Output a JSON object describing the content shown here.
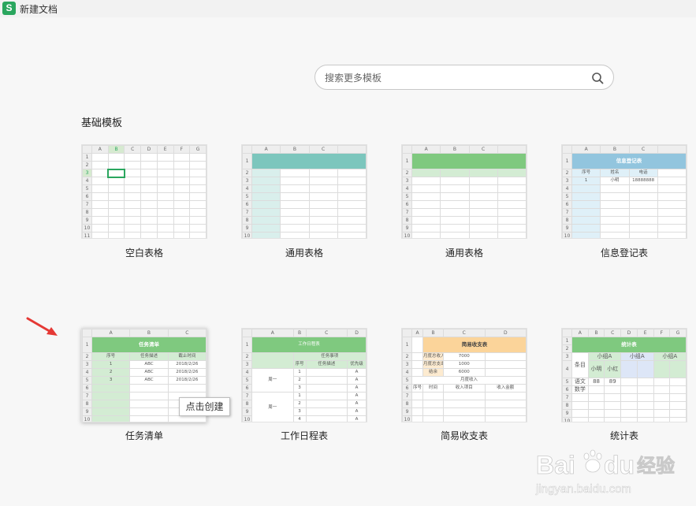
{
  "window": {
    "title": "新建文档",
    "app_icon_letter": "S"
  },
  "search": {
    "placeholder": "搜索更多模板"
  },
  "section": {
    "title": "基础模板"
  },
  "templates": [
    {
      "name": "空白表格"
    },
    {
      "name": "通用表格"
    },
    {
      "name": "通用表格"
    },
    {
      "name": "信息登记表",
      "header": "信息登记表",
      "cols": [
        "序号",
        "姓名",
        "电话"
      ],
      "row": [
        "1",
        "小明",
        "18888888"
      ]
    },
    {
      "name": "任务清单",
      "header": "任务清单",
      "cols": [
        "序号",
        "任务描述",
        "截止时间"
      ],
      "rows": [
        [
          "1",
          "ABC",
          "2018/2/26"
        ],
        [
          "2",
          "ABC",
          "2018/2/26"
        ],
        [
          "3",
          "ABC",
          "2018/2/26"
        ]
      ]
    },
    {
      "name": "工作日程表",
      "header": "工作日程表",
      "sub": "任务事项",
      "cols": [
        "序号",
        "任务描述",
        "优先级"
      ],
      "group1": "周一",
      "group2": "周一",
      "nums": [
        "1",
        "2",
        "3",
        "1",
        "2",
        "3",
        "4"
      ],
      "pri": "A"
    },
    {
      "name": "简易收支表",
      "header": "简易收支表",
      "items": [
        [
          "月度总收入",
          "7000"
        ],
        [
          "月度总支出",
          "1000"
        ],
        [
          "结余",
          "6000"
        ]
      ],
      "sub": "月度收入",
      "cols": [
        "序号",
        "时间",
        "收入项目",
        "收入金额"
      ]
    },
    {
      "name": "统计表",
      "header": "统计表",
      "row_label": "条目",
      "groups": [
        "小组A",
        "小组A",
        "小组A"
      ],
      "members": [
        "小明",
        "小红"
      ],
      "subjects": [
        "语文",
        "数学"
      ],
      "scores": [
        "88",
        "89"
      ]
    }
  ],
  "tooltip": {
    "text": "点击创建"
  },
  "colors": {
    "green": "#2aa65e",
    "teal": "#7cc6bd",
    "light_green": "#7fc97f",
    "blue": "#92c5de",
    "orange": "#fbd49a",
    "red": "#e53935"
  }
}
